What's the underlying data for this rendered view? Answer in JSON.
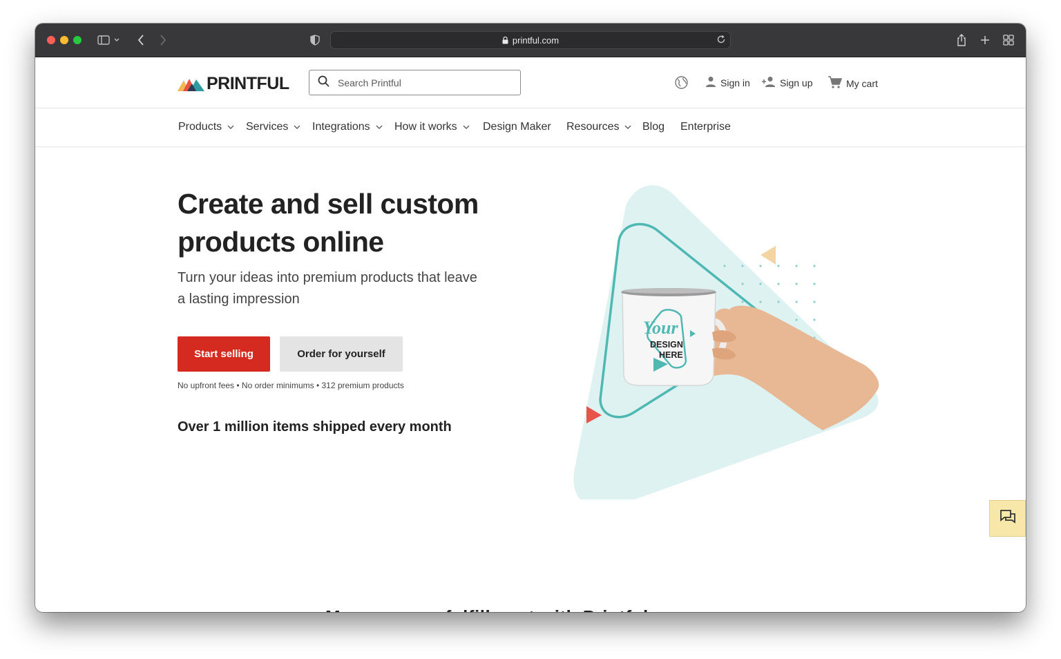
{
  "browser": {
    "url": "printful.com",
    "colors": {
      "close": "#ff5f57",
      "minimize": "#febc2e",
      "zoom": "#28c840"
    }
  },
  "header": {
    "logo_text": "PRINTFUL",
    "search_placeholder": "Search Printful",
    "sign_in": "Sign in",
    "sign_up": "Sign up",
    "cart": "My cart"
  },
  "nav": {
    "items": [
      {
        "label": "Products",
        "dropdown": true
      },
      {
        "label": "Services",
        "dropdown": true
      },
      {
        "label": "Integrations",
        "dropdown": true
      },
      {
        "label": "How it works",
        "dropdown": true
      },
      {
        "label": "Design Maker",
        "dropdown": false
      },
      {
        "label": "Resources",
        "dropdown": true
      },
      {
        "label": "Blog",
        "dropdown": false
      },
      {
        "label": "Enterprise",
        "dropdown": false
      }
    ]
  },
  "hero": {
    "title": "Create and sell custom products online",
    "subtitle": "Turn your ideas into premium products that leave a lasting impression",
    "primary_cta": "Start selling",
    "secondary_cta": "Order for yourself",
    "fine_print": "No upfront fees • No order minimums • 312 premium products",
    "stat": "Over 1 million items shipped every month",
    "mug_text": {
      "line1": "Your",
      "line2": "DESIGN",
      "line3": "HERE"
    }
  },
  "next_section_peek": "Manage your fulfillment with Printful",
  "colors": {
    "brand_red": "#d42a1f",
    "teal": "#4fb8b3",
    "teal_light": "#def2f1",
    "chat_bg": "#f7e7a9"
  }
}
